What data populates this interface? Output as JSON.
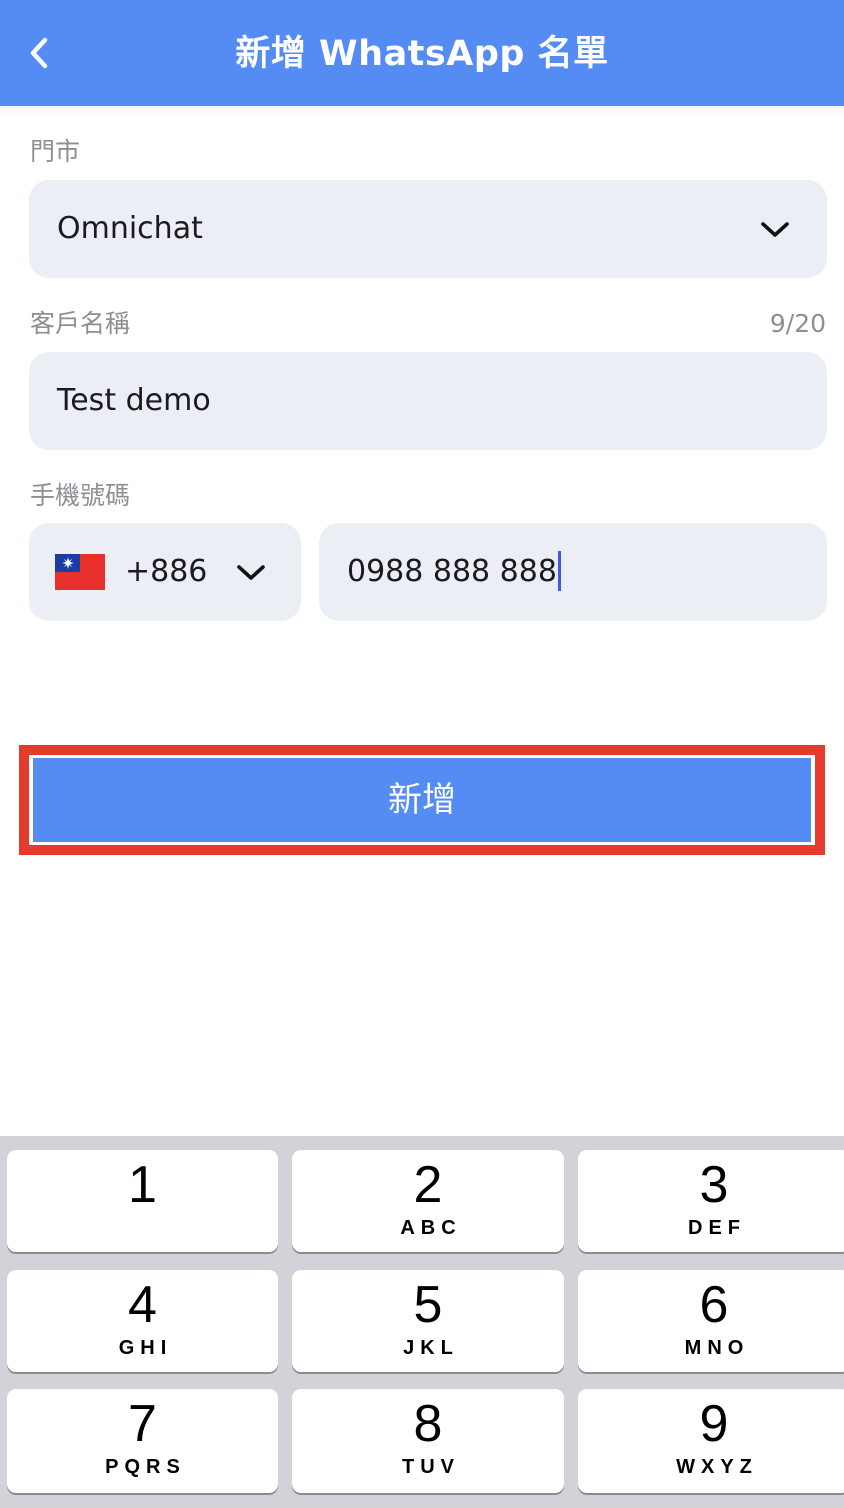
{
  "header": {
    "title": "新增 WhatsApp 名單",
    "background_color": "#548cf4"
  },
  "form": {
    "store": {
      "label": "門市",
      "value": "Omnichat"
    },
    "customer_name": {
      "label": "客戶名稱",
      "counter": "9/20",
      "value": "Test demo"
    },
    "phone": {
      "label": "手機號碼",
      "country_code": "+886",
      "country_flag": "taiwan-flag-icon",
      "value": "0988 888 888"
    }
  },
  "submit": {
    "label": "新增",
    "highlight_color": "#e43b2c"
  },
  "keypad": {
    "keys": [
      {
        "digit": "1",
        "letters": ""
      },
      {
        "digit": "2",
        "letters": "ABC"
      },
      {
        "digit": "3",
        "letters": "DEF"
      },
      {
        "digit": "4",
        "letters": "GHI"
      },
      {
        "digit": "5",
        "letters": "JKL"
      },
      {
        "digit": "6",
        "letters": "MNO"
      },
      {
        "digit": "7",
        "letters": "PQRS"
      },
      {
        "digit": "8",
        "letters": "TUV"
      },
      {
        "digit": "9",
        "letters": "WXYZ"
      }
    ]
  }
}
